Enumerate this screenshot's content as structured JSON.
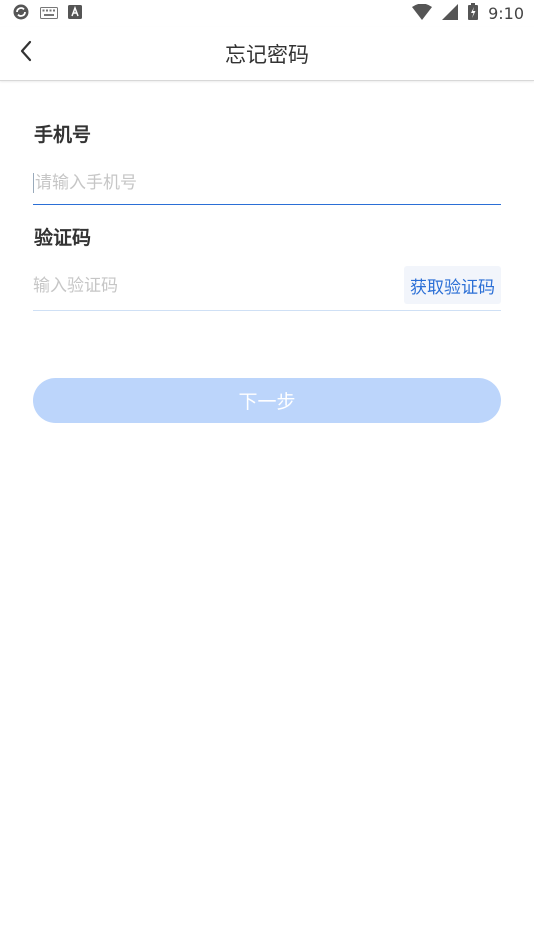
{
  "status_bar": {
    "time": "9:10",
    "left_icons": [
      "sync-icon",
      "keyboard-icon",
      "font-icon"
    ],
    "right_icons": [
      "wifi-icon",
      "signal-icon",
      "battery-icon"
    ]
  },
  "header": {
    "title": "忘记密码",
    "back_icon": "chevron-left-icon"
  },
  "form": {
    "phone_label": "手机号",
    "phone_placeholder": "请输入手机号",
    "phone_value": "",
    "code_label": "验证码",
    "code_placeholder": "输入验证码",
    "code_value": "",
    "get_code_label": "获取验证码",
    "next_label": "下一步"
  },
  "colors": {
    "accent": "#2b6fd6",
    "active_underline": "#2b6fd6",
    "inactive_underline": "#cfe0f5",
    "next_button_disabled": "#bcd5fb"
  }
}
